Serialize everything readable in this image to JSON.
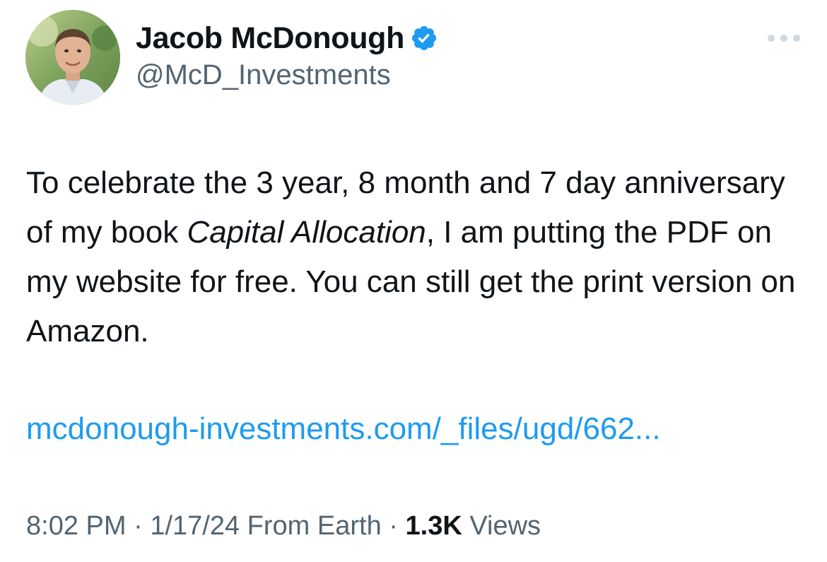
{
  "author": {
    "display_name": "Jacob McDonough",
    "handle": "@McD_Investments",
    "verified_icon": "verified-badge-icon"
  },
  "more_icon": "ellipsis-icon",
  "tweet": {
    "text_before": "To celebrate the 3 year, 8 month and 7 day anniversary of my book ",
    "text_italic": "Capital Allocation",
    "text_after": ", I am putting the PDF on my website for free. You can still get the print version on Amazon.",
    "link": "mcdonough-investments.com/_files/ugd/662..."
  },
  "meta": {
    "time": "8:02 PM",
    "sep1": " · ",
    "date": "1/17/24",
    "location": " From Earth",
    "sep2": " · ",
    "views_count": "1.3K",
    "views_label": " Views"
  },
  "colors": {
    "link": "#1d9bf0",
    "verified": "#1d9bf0",
    "secondary_text": "#536471",
    "primary_text": "#0f1419"
  }
}
